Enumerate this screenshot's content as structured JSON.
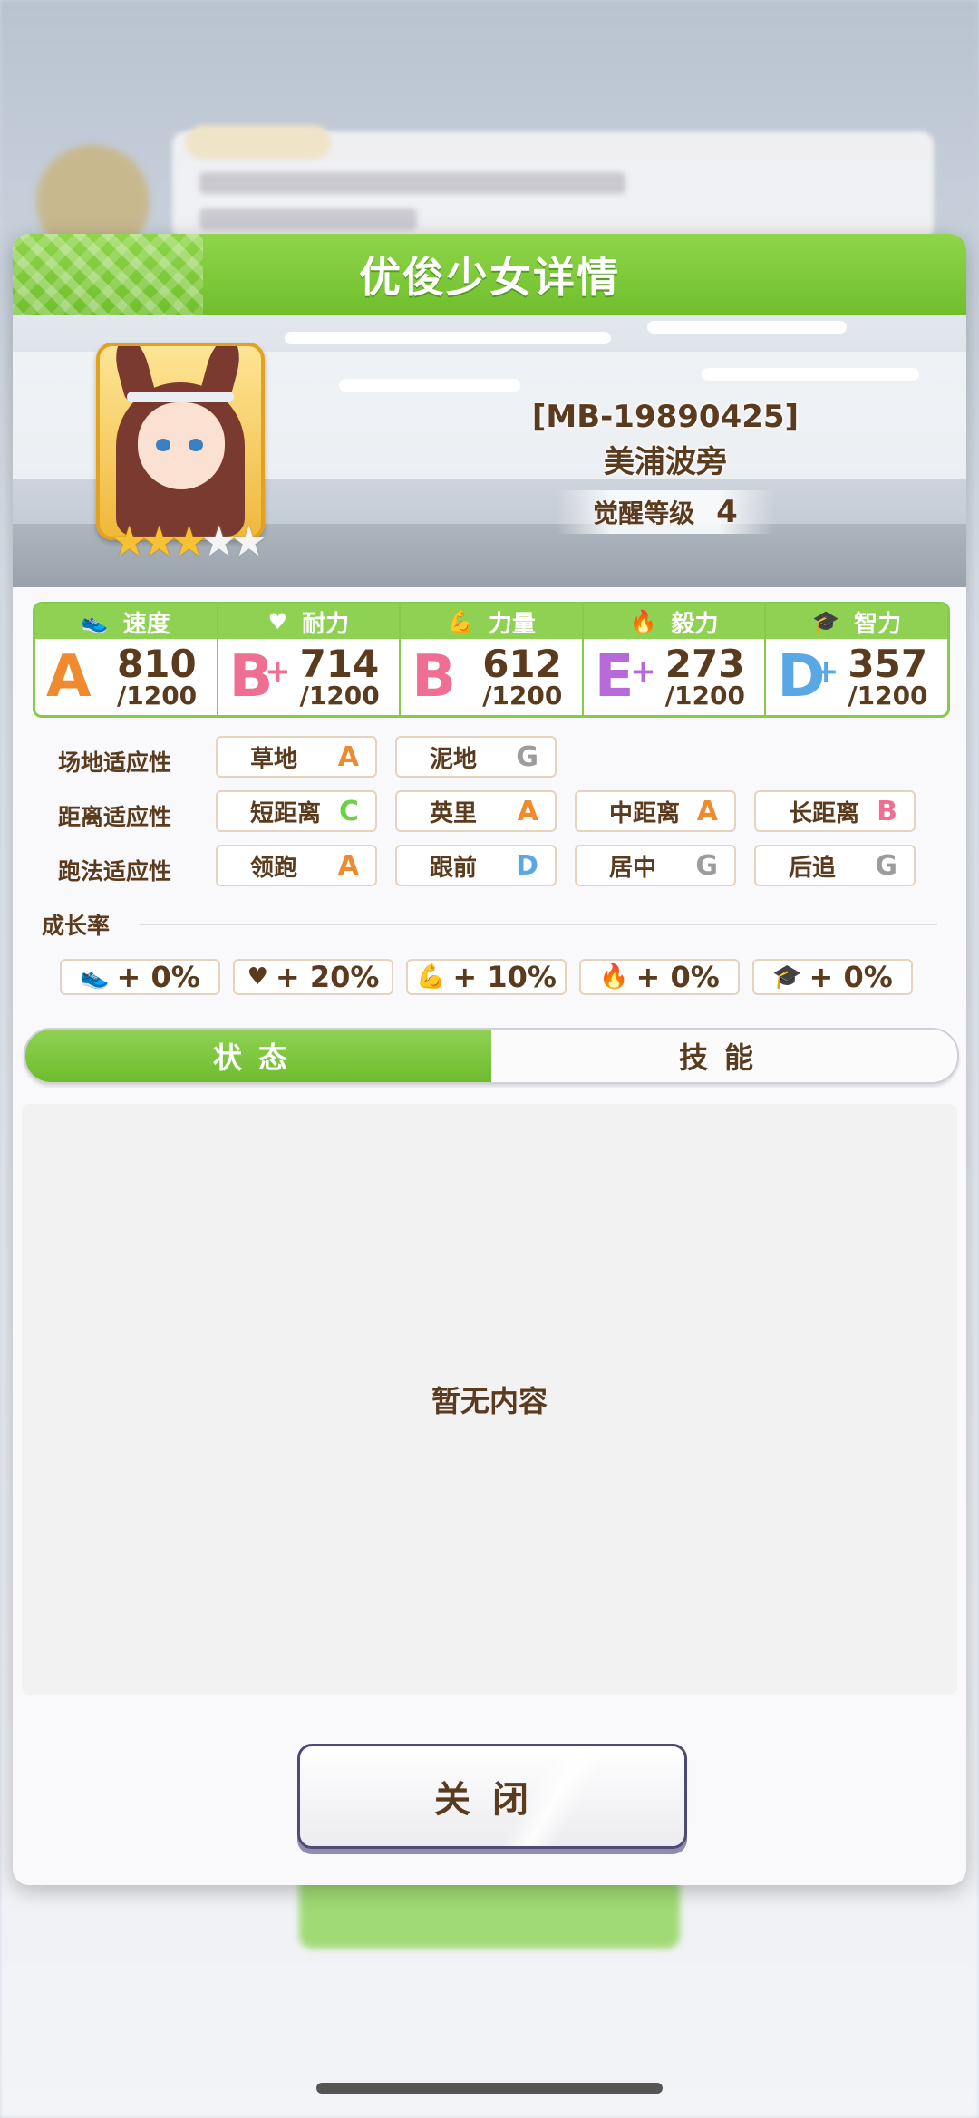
{
  "dialog": {
    "title": "优俊少女详情",
    "character": {
      "code": "[MB-19890425]",
      "name": "美浦波旁",
      "awakening_label": "觉醒等级",
      "awakening_level": "4",
      "stars_filled": 3,
      "stars_total": 5
    },
    "stats": [
      {
        "label": "速度",
        "icon": "shoe-icon",
        "glyph": "👟",
        "grade": "A",
        "plus": "",
        "value": "810",
        "max": "/1200"
      },
      {
        "label": "耐力",
        "icon": "heart-icon",
        "glyph": "♥",
        "grade": "B",
        "plus": "+",
        "value": "714",
        "max": "/1200"
      },
      {
        "label": "力量",
        "icon": "muscle-icon",
        "glyph": "💪",
        "grade": "B",
        "plus": "",
        "value": "612",
        "max": "/1200"
      },
      {
        "label": "毅力",
        "icon": "flame-icon",
        "glyph": "🔥",
        "grade": "E",
        "plus": "+",
        "value": "273",
        "max": "/1200"
      },
      {
        "label": "智力",
        "icon": "graduation-cap-icon",
        "glyph": "🎓",
        "grade": "D",
        "plus": "+",
        "value": "357",
        "max": "/1200"
      }
    ],
    "aptitude": {
      "track": {
        "label": "场地适应性",
        "items": [
          {
            "name": "草地",
            "grade": "A"
          },
          {
            "name": "泥地",
            "grade": "G"
          }
        ]
      },
      "distance": {
        "label": "距离适应性",
        "items": [
          {
            "name": "短距离",
            "grade": "C"
          },
          {
            "name": "英里",
            "grade": "A"
          },
          {
            "name": "中距离",
            "grade": "A"
          },
          {
            "name": "长距离",
            "grade": "B"
          }
        ]
      },
      "style": {
        "label": "跑法适应性",
        "items": [
          {
            "name": "领跑",
            "grade": "A"
          },
          {
            "name": "跟前",
            "grade": "D"
          },
          {
            "name": "居中",
            "grade": "G"
          },
          {
            "name": "后追",
            "grade": "G"
          }
        ]
      }
    },
    "growth": {
      "label": "成长率",
      "items": [
        {
          "icon": "shoe-icon",
          "glyph": "👟",
          "value": "+ 0%"
        },
        {
          "icon": "heart-icon",
          "glyph": "♥",
          "value": "+ 20%"
        },
        {
          "icon": "muscle-icon",
          "glyph": "💪",
          "value": "+ 10%"
        },
        {
          "icon": "flame-icon",
          "glyph": "🔥",
          "value": "+ 0%"
        },
        {
          "icon": "graduation-cap-icon",
          "glyph": "🎓",
          "value": "+ 0%"
        }
      ]
    },
    "tabs": {
      "status": "状态",
      "skills": "技能"
    },
    "empty_text": "暂无内容",
    "close_label": "关闭"
  },
  "colors": {
    "accent_green": "#7cc83a",
    "text_brown": "#5b3b1e",
    "grade_A": "#f08a2f",
    "grade_B": "#ef6f93",
    "grade_C": "#6fcf45",
    "grade_D": "#5aa7e6",
    "grade_E": "#b66ad9",
    "grade_G": "#9c9c9c"
  }
}
